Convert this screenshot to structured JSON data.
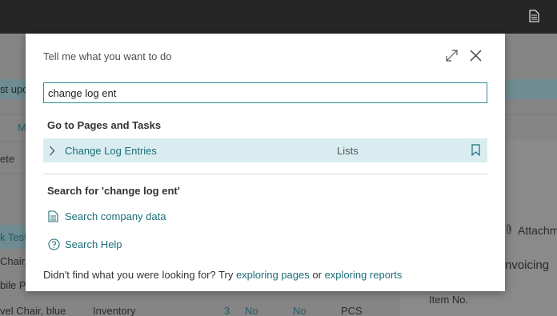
{
  "background": {
    "texts": {
      "last_updated": "st upd",
      "m_tab": "M",
      "ete": "ete",
      "k_test": "k Test",
      "chair": "Chair,",
      "bile_pe": "bile Pe",
      "row_item": "vel Chair, blue",
      "row_category": "Inventory",
      "row_qty": "3",
      "row_no1": "No",
      "row_no2": "No",
      "row_unit": "PCS",
      "attachments": "Attachm",
      "invoicing": "nvoicing",
      "item_no": "Item No."
    }
  },
  "dialog": {
    "title": "Tell me what you want to do",
    "search_value": "change log ent",
    "pages_section_title": "Go to Pages and Tasks",
    "results": [
      {
        "label": "Change Log Entries",
        "category": "Lists"
      }
    ],
    "search_section_title": "Search for 'change log ent'",
    "actions": [
      {
        "label": "Search company data",
        "icon": "database-icon"
      },
      {
        "label": "Search Help",
        "icon": "help-icon"
      }
    ],
    "footer": {
      "prefix": "Didn't find what you were looking for? Try",
      "link1": "exploring pages",
      "middle": "or",
      "link2": "exploring reports"
    }
  },
  "colors": {
    "accent": "#1c6d78",
    "input_border": "#2f8a94",
    "result_highlight": "#d9edf0",
    "topbar": "#262626"
  }
}
